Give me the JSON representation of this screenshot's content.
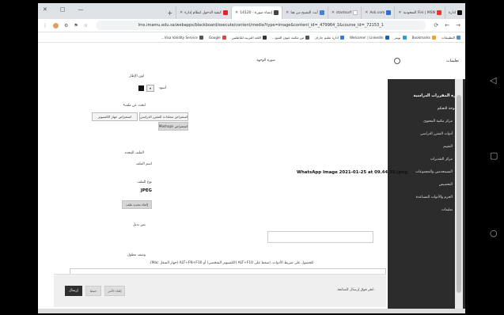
{
  "window": {
    "controls": [
      "✕",
      "▢",
      "—"
    ],
    "new_tab": "+"
  },
  "tabs": [
    {
      "label": "ادارة",
      "color": "#111111",
      "active": false
    },
    {
      "label": "Fini | MSN السعودية",
      "color": "#e23b2e",
      "active": false
    },
    {
      "label": "Ask.com",
      "color": "#2c6ed5",
      "active": false
    },
    {
      "label": "startsurf",
      "color": "#ffffff",
      "active": false
    },
    {
      "label": "أيث التسبح من هنا",
      "color": "#4a7fd6",
      "active": false
    },
    {
      "label": "إنشاء صورة - 14120",
      "color": "#444444",
      "active": true
    },
    {
      "label": "كيفية الدخول لنظام إدارة",
      "color": "#e0262a",
      "active": false
    }
  ],
  "address_bar": {
    "url": "lms.imamu.edu.sa/webapps/blackboard/execute/content/media?type=image&content_id=_479964_1&course_id=_72153_1",
    "nav": [
      "→",
      "←",
      "⟳"
    ],
    "right_icons": [
      "☆",
      "⚑",
      "⚙",
      "⋮"
    ]
  },
  "bookmarks": [
    {
      "label": "التطبيقات",
      "color": "#4a90d9"
    },
    {
      "label": "Bookmarks",
      "color": "#e8a33d"
    },
    {
      "label": "تويتر",
      "color": "#1da1f2"
    },
    {
      "label": "Welcome! | LinkedIn",
      "color": "#0a66c2"
    },
    {
      "label": "ادارة تعليم جازان",
      "color": "#3a7bd5"
    },
    {
      "label": "من مكتبة عيون الشع...",
      "color": "#555555"
    },
    {
      "label": "اللغة العربية للناطقين",
      "color": "#333333"
    },
    {
      "label": "Google",
      "color": "#ea4335"
    },
    {
      "label": "Visa Validity Service...",
      "color": "#555555"
    }
  ],
  "sidebar_header": {
    "title": "تعليمات"
  },
  "sidebar": {
    "section_title": "إدارة المقررات الدراسية",
    "group_title": "لوحة التحكم",
    "items": [
      "مركز مكتبة المحتوى",
      "أدوات المقرر الدراسي",
      "التقييم",
      "مركز التقديرات",
      "المستخدمين والمجموعات",
      "التخصيص",
      "الحزم والأدوات المساعدة",
      "تعليمات"
    ]
  },
  "form": {
    "image_source_label": "صورة الوجهة",
    "color_label": "لون الإطار",
    "color_value": "أسود",
    "search_label": "ابحث عن ملف",
    "browse_computer": "استعراض جهاز الكمبيوتر",
    "browse_course": "استعراض مجلدات المقرر الدراسي",
    "mashups": "استعراض Mashups",
    "selected_file_label": "الملف المحدد",
    "file_name_label": "اسم الملف",
    "file_name": "WhatsApp Image 2021-01-25 at 09.44.38.jpeg",
    "file_type_label": "نوع الملف",
    "file_type": "JPEG",
    "remove_file": "إلغاء تحديد ملف",
    "alt_text_label": "نص بديل",
    "long_desc_label": "وصف مطول",
    "toolbar_hint": "للحصول على شريط الأدوات، اضغط على ALT+F10 (الكمبيوتر الشخصي) أو ALT+FN+F10 (جهاز الشغل Mac)."
  },
  "bottom": {
    "message": "انقر فوق إرسال للمتابعة.",
    "submit": "إرسال",
    "save": "حفظ",
    "cancel": "إلغاء الأمر"
  },
  "android_nav": [
    "◁",
    "▢",
    "○"
  ]
}
